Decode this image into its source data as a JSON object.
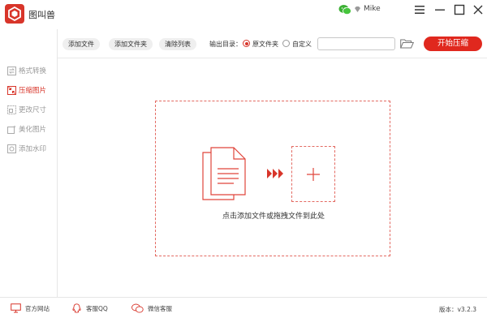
{
  "app": {
    "title": "图叫兽",
    "username": "Mike"
  },
  "sidebar": {
    "items": [
      {
        "label": "格式转换",
        "icon": "format-convert-icon",
        "active": false
      },
      {
        "label": "压缩图片",
        "icon": "compress-icon",
        "active": true
      },
      {
        "label": "更改尺寸",
        "icon": "resize-icon",
        "active": false
      },
      {
        "label": "美化图片",
        "icon": "beautify-icon",
        "active": false
      },
      {
        "label": "添加水印",
        "icon": "watermark-icon",
        "active": false
      }
    ]
  },
  "toolbar": {
    "add_file": "添加文件",
    "add_folder": "添加文件夹",
    "clear_list": "清除列表",
    "output_label": "输出目录：",
    "radio_original": "原文件夹",
    "radio_custom": "自定义",
    "selected_output": "原文件夹",
    "path_value": "",
    "start": "开始压缩"
  },
  "main": {
    "drop_hint": "点击添加文件或拖拽文件到此处"
  },
  "footer": {
    "website": "官方网站",
    "qq": "客服QQ",
    "wechat": "微信客服",
    "version": "版本：v3.2.3"
  },
  "colors": {
    "accent": "#e0281e",
    "dashed_border": "#e36a62",
    "active_text": "#d8352a"
  }
}
